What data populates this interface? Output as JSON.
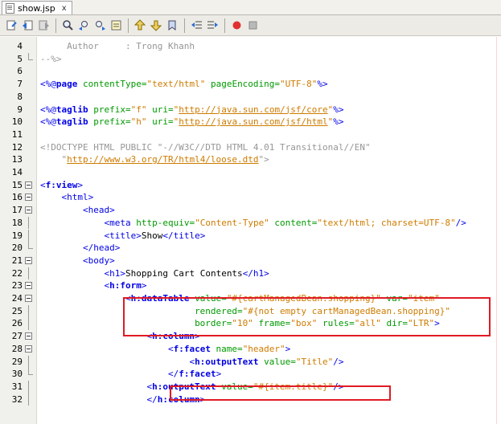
{
  "tab": {
    "title": "show.jsp",
    "close": "x"
  },
  "toolbar": {
    "icons": [
      "last-edit-icon",
      "back-icon",
      "forward-icon",
      "find-icon",
      "find-previous-icon",
      "find-next-icon",
      "toggle-highlight-icon",
      "previous-bookmark-icon",
      "next-bookmark-icon",
      "toggle-bookmark-icon",
      "shift-left-icon",
      "shift-right-icon",
      "macro-record-icon",
      "macro-stop-icon"
    ]
  },
  "colors": {
    "tag": "#0000e6",
    "attr": "#009900",
    "value": "#ce7b00",
    "comment": "#969696",
    "highlight": "#e01b24"
  },
  "lines": [
    {
      "n": "4",
      "t": [
        [
          "cmt",
          "     Author     : Trong Khanh"
        ]
      ]
    },
    {
      "n": "5",
      "t": [
        [
          "cmt",
          "--%>"
        ]
      ]
    },
    {
      "n": "6",
      "t": []
    },
    {
      "n": "7",
      "t": [
        [
          "dir",
          "<%@"
        ],
        [
          "dirb",
          "page"
        ],
        [
          "attr",
          " contentType="
        ],
        [
          "val",
          "\"text/html\""
        ],
        [
          "attr",
          " pageEncoding="
        ],
        [
          "val",
          "\"UTF-8\""
        ],
        [
          "dir",
          "%>"
        ]
      ]
    },
    {
      "n": "8",
      "t": []
    },
    {
      "n": "9",
      "t": [
        [
          "dir",
          "<%@"
        ],
        [
          "dirb",
          "taglib"
        ],
        [
          "attr",
          " prefix="
        ],
        [
          "val",
          "\"f\""
        ],
        [
          "attr",
          " uri="
        ],
        [
          "val",
          "\""
        ],
        [
          "url",
          "http://java.sun.com/jsf/core"
        ],
        [
          "val",
          "\""
        ],
        [
          "dir",
          "%>"
        ]
      ]
    },
    {
      "n": "10",
      "t": [
        [
          "dir",
          "<%@"
        ],
        [
          "dirb",
          "taglib"
        ],
        [
          "attr",
          " prefix="
        ],
        [
          "val",
          "\"h\""
        ],
        [
          "attr",
          " uri="
        ],
        [
          "val",
          "\""
        ],
        [
          "url",
          "http://java.sun.com/jsf/html"
        ],
        [
          "val",
          "\""
        ],
        [
          "dir",
          "%>"
        ]
      ]
    },
    {
      "n": "11",
      "t": []
    },
    {
      "n": "12",
      "t": [
        [
          "cmt",
          "<!DOCTYPE HTML PUBLIC \"-//W3C//DTD HTML 4.01 Transitional//EN\""
        ]
      ]
    },
    {
      "n": "13",
      "t": [
        [
          "cmt",
          "    \""
        ],
        [
          "url",
          "http://www.w3.org/TR/html4/loose.dtd"
        ],
        [
          "cmt",
          "\">"
        ]
      ]
    },
    {
      "n": "14",
      "t": []
    },
    {
      "n": "15",
      "t": [
        [
          "tag",
          "<"
        ],
        [
          "b",
          "f:view"
        ],
        [
          "tag",
          ">"
        ]
      ]
    },
    {
      "n": "16",
      "t": [
        [
          "txt",
          "    "
        ],
        [
          "tag",
          "<html>"
        ]
      ]
    },
    {
      "n": "17",
      "t": [
        [
          "txt",
          "        "
        ],
        [
          "tag",
          "<head>"
        ]
      ]
    },
    {
      "n": "18",
      "t": [
        [
          "txt",
          "            "
        ],
        [
          "tag",
          "<meta"
        ],
        [
          "attr",
          " http-equiv="
        ],
        [
          "val",
          "\"Content-Type\""
        ],
        [
          "attr",
          " content="
        ],
        [
          "val",
          "\"text/html; charset=UTF-8\""
        ],
        [
          "tag",
          "/>"
        ]
      ]
    },
    {
      "n": "19",
      "t": [
        [
          "txt",
          "            "
        ],
        [
          "tag",
          "<title>"
        ],
        [
          "txt",
          "Show"
        ],
        [
          "tag",
          "</title>"
        ]
      ]
    },
    {
      "n": "20",
      "t": [
        [
          "txt",
          "        "
        ],
        [
          "tag",
          "</head>"
        ]
      ]
    },
    {
      "n": "21",
      "t": [
        [
          "txt",
          "        "
        ],
        [
          "tag",
          "<body>"
        ]
      ]
    },
    {
      "n": "22",
      "t": [
        [
          "txt",
          "            "
        ],
        [
          "tag",
          "<h1>"
        ],
        [
          "txt",
          "Shopping Cart Contents"
        ],
        [
          "tag",
          "</h1>"
        ]
      ]
    },
    {
      "n": "23",
      "t": [
        [
          "txt",
          "            "
        ],
        [
          "tag",
          "<"
        ],
        [
          "b",
          "h:form"
        ],
        [
          "tag",
          ">"
        ]
      ]
    },
    {
      "n": "24",
      "t": [
        [
          "txt",
          "                "
        ],
        [
          "tag",
          "<"
        ],
        [
          "b",
          "h:dataTable"
        ],
        [
          "attr",
          " value="
        ],
        [
          "val",
          "\"#{cartManagedBean.shopping}\""
        ],
        [
          "attr",
          " var="
        ],
        [
          "val",
          "\"item\""
        ]
      ]
    },
    {
      "n": "25",
      "t": [
        [
          "txt",
          "                             "
        ],
        [
          "attr",
          "rendered="
        ],
        [
          "val",
          "\"#{not empty cartManagedBean.shopping}\""
        ]
      ]
    },
    {
      "n": "26",
      "t": [
        [
          "txt",
          "                             "
        ],
        [
          "attr",
          "border="
        ],
        [
          "val",
          "\"10\""
        ],
        [
          "attr",
          " frame="
        ],
        [
          "val",
          "\"box\""
        ],
        [
          "attr",
          " rules="
        ],
        [
          "val",
          "\"all\""
        ],
        [
          "attr",
          " dir="
        ],
        [
          "val",
          "\"LTR\""
        ],
        [
          "tag",
          ">"
        ]
      ]
    },
    {
      "n": "27",
      "t": [
        [
          "txt",
          "                    "
        ],
        [
          "tag",
          "<"
        ],
        [
          "b",
          "h:column"
        ],
        [
          "tag",
          ">"
        ]
      ]
    },
    {
      "n": "28",
      "t": [
        [
          "txt",
          "                        "
        ],
        [
          "tag",
          "<"
        ],
        [
          "b",
          "f:facet"
        ],
        [
          "attr",
          " name="
        ],
        [
          "val",
          "\"header\""
        ],
        [
          "tag",
          ">"
        ]
      ]
    },
    {
      "n": "29",
      "t": [
        [
          "txt",
          "                            "
        ],
        [
          "tag",
          "<"
        ],
        [
          "b",
          "h:outputText"
        ],
        [
          "attr",
          " value="
        ],
        [
          "val",
          "\"Title\""
        ],
        [
          "tag",
          "/>"
        ]
      ]
    },
    {
      "n": "30",
      "t": [
        [
          "txt",
          "                        "
        ],
        [
          "tag",
          "</"
        ],
        [
          "b",
          "f:facet"
        ],
        [
          "tag",
          ">"
        ]
      ]
    },
    {
      "n": "31",
      "t": [
        [
          "txt",
          "                    "
        ],
        [
          "tag",
          "<"
        ],
        [
          "b",
          "h:outputText"
        ],
        [
          "attr",
          " value="
        ],
        [
          "val",
          "\"#{item.title}\""
        ],
        [
          "tag",
          "/>"
        ]
      ]
    },
    {
      "n": "32",
      "t": [
        [
          "txt",
          "                    "
        ],
        [
          "tag",
          "</"
        ],
        [
          "b",
          "h:column"
        ],
        [
          "tag",
          ">"
        ]
      ]
    }
  ]
}
